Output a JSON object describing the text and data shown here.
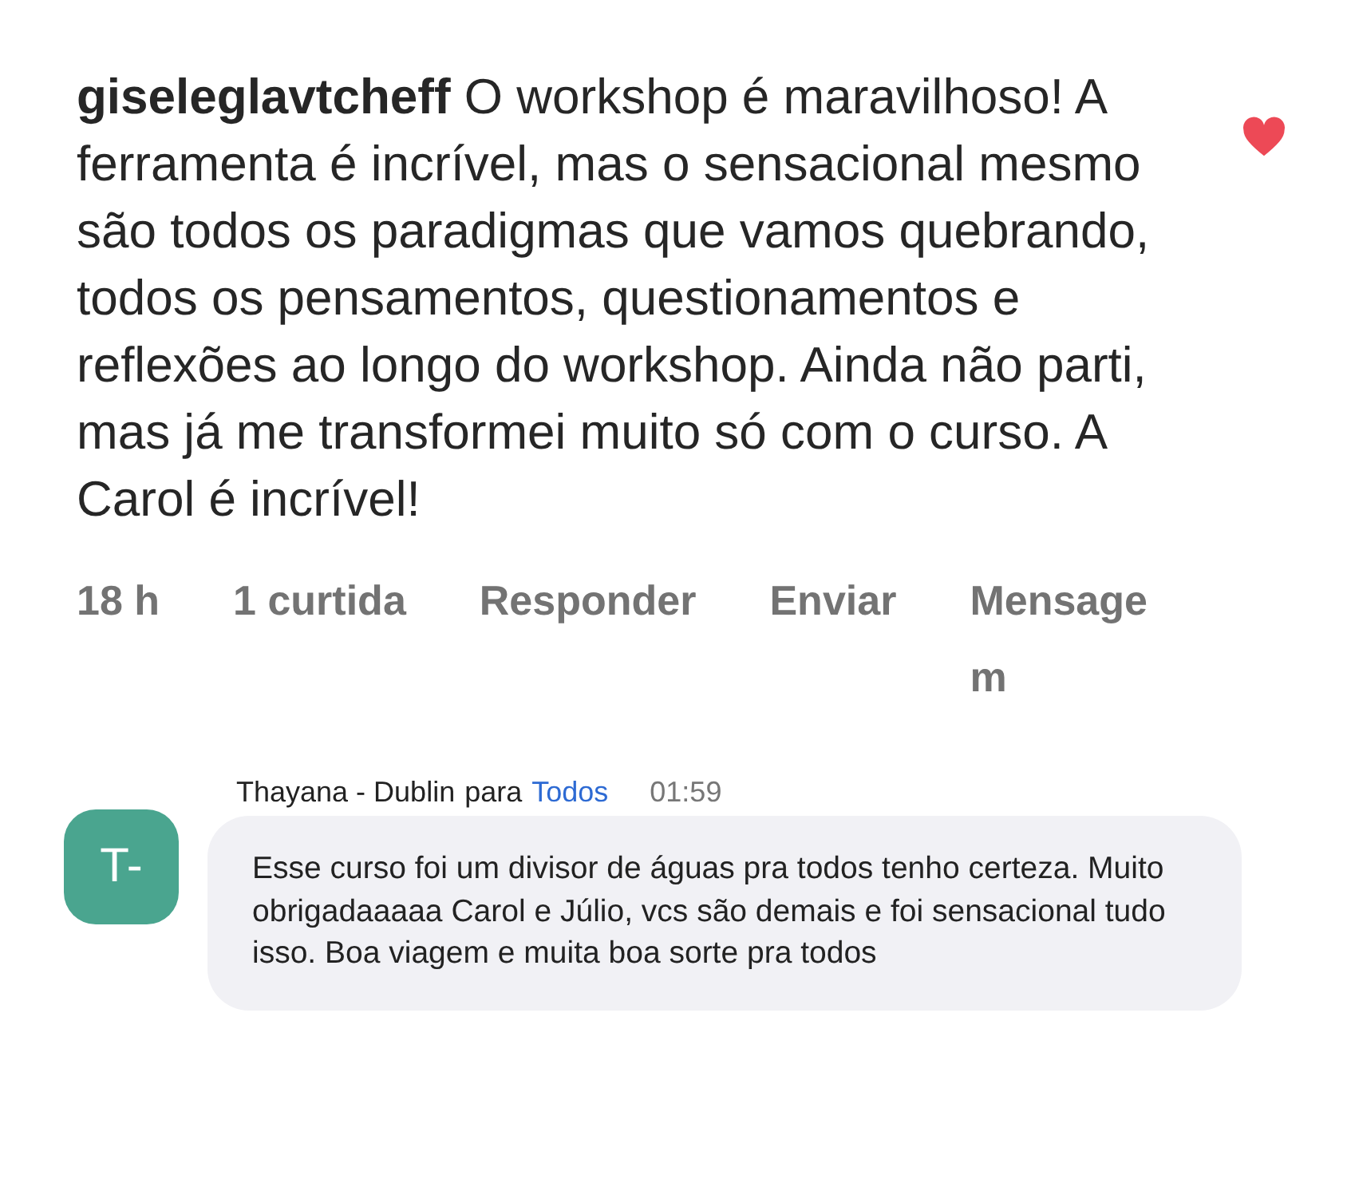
{
  "comment": {
    "text": "**giseleglavtcheff** O workshop é maravilhoso! A ferramenta é incrível, mas o sensacional mesmo são todos os paradigmas que vamos quebrando, todos os pensamentos, questionamentos e reflexões ao longo do workshop. Ainda não parti, mas já me transformei muito só com o curso. A Carol é incrível!",
    "liked": true,
    "actions": [
      {
        "kind": "time",
        "label": "18 h"
      },
      {
        "kind": "likes",
        "label": "1 curtida"
      },
      {
        "kind": "link",
        "label": "Responder"
      },
      {
        "kind": "link",
        "label": "Enviar"
      },
      {
        "kind": "link",
        "label": "Mensagem"
      }
    ]
  },
  "chat": {
    "avatar": "T-",
    "sender": "Thayana - Dublin",
    "to_word": "para",
    "recipient": "Todos",
    "time": "01:59",
    "message": "Esse curso foi um divisor de águas pra todos tenho certeza. Muito obrigadaaaaa Carol e Júlio, vcs são demais e foi sensacional tudo isso. Boa viagem e muita boa sorte pra todos"
  }
}
